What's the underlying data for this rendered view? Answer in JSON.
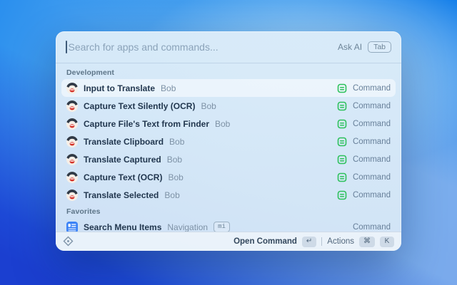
{
  "window": {
    "search": {
      "placeholder": "Search for apps and commands...",
      "ask_ai_label": "Ask AI",
      "tab_key": "Tab"
    },
    "sections": [
      {
        "title": "Development",
        "items": [
          {
            "title": "Input to Translate",
            "subtitle": "Bob",
            "type": "Command"
          },
          {
            "title": "Capture Text Silently (OCR)",
            "subtitle": "Bob",
            "type": "Command"
          },
          {
            "title": "Capture File's Text from Finder",
            "subtitle": "Bob",
            "type": "Command"
          },
          {
            "title": "Translate Clipboard",
            "subtitle": "Bob",
            "type": "Command"
          },
          {
            "title": "Translate Captured",
            "subtitle": "Bob",
            "type": "Command"
          },
          {
            "title": "Capture Text (OCR)",
            "subtitle": "Bob",
            "type": "Command"
          },
          {
            "title": "Translate Selected",
            "subtitle": "Bob",
            "type": "Command"
          }
        ]
      },
      {
        "title": "Favorites",
        "items": [
          {
            "title": "Search Menu Items",
            "subtitle": "Navigation",
            "alias": "mi",
            "type": "Command"
          }
        ]
      }
    ],
    "footer": {
      "primary_action": "Open Command",
      "enter_key": "↵",
      "actions_label": "Actions",
      "cmd_key": "⌘",
      "k_key": "K"
    }
  },
  "colors": {
    "accent_green": "#2ec15c",
    "menu_icon_blue": "#3b82f6",
    "wallpaper_deep_blue": "#1b3fd0",
    "wallpaper_light_blue": "#79bef2"
  }
}
